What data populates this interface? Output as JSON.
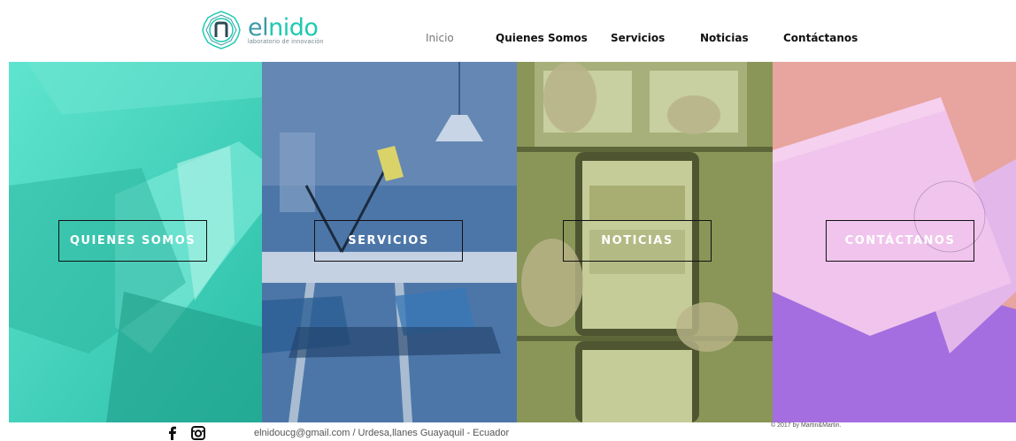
{
  "logo": {
    "name_part1": "el",
    "name_part2": "nido",
    "tagline": "laboratorio de innovación"
  },
  "nav": {
    "items": [
      {
        "label": "Inicio",
        "active": true
      },
      {
        "label": "Quienes Somos",
        "active": false
      },
      {
        "label": "Servicios",
        "active": false
      },
      {
        "label": "Noticias",
        "active": false
      },
      {
        "label": "Contáctanos",
        "active": false
      }
    ]
  },
  "panels": [
    {
      "label": "QUIENES SOMOS",
      "tint": "#3fd9c1"
    },
    {
      "label": "SERVICIOS",
      "tint": "#4f7fb5"
    },
    {
      "label": "NOTICIAS",
      "tint": "#8e9a5a"
    },
    {
      "label": "CONTÁCTANOS",
      "tint": "#e6a8d8"
    }
  ],
  "footer": {
    "contact": "elnidoucg@gmail.com / Urdesa,llanes Guayaquil - Ecuador",
    "copyright": "© 2017 by Martin&Martin.",
    "social_icons": [
      "facebook-icon",
      "instagram-icon"
    ]
  },
  "colors": {
    "brand_teal": "#1ec9b0",
    "brand_dark_teal": "#3a9aa8"
  }
}
